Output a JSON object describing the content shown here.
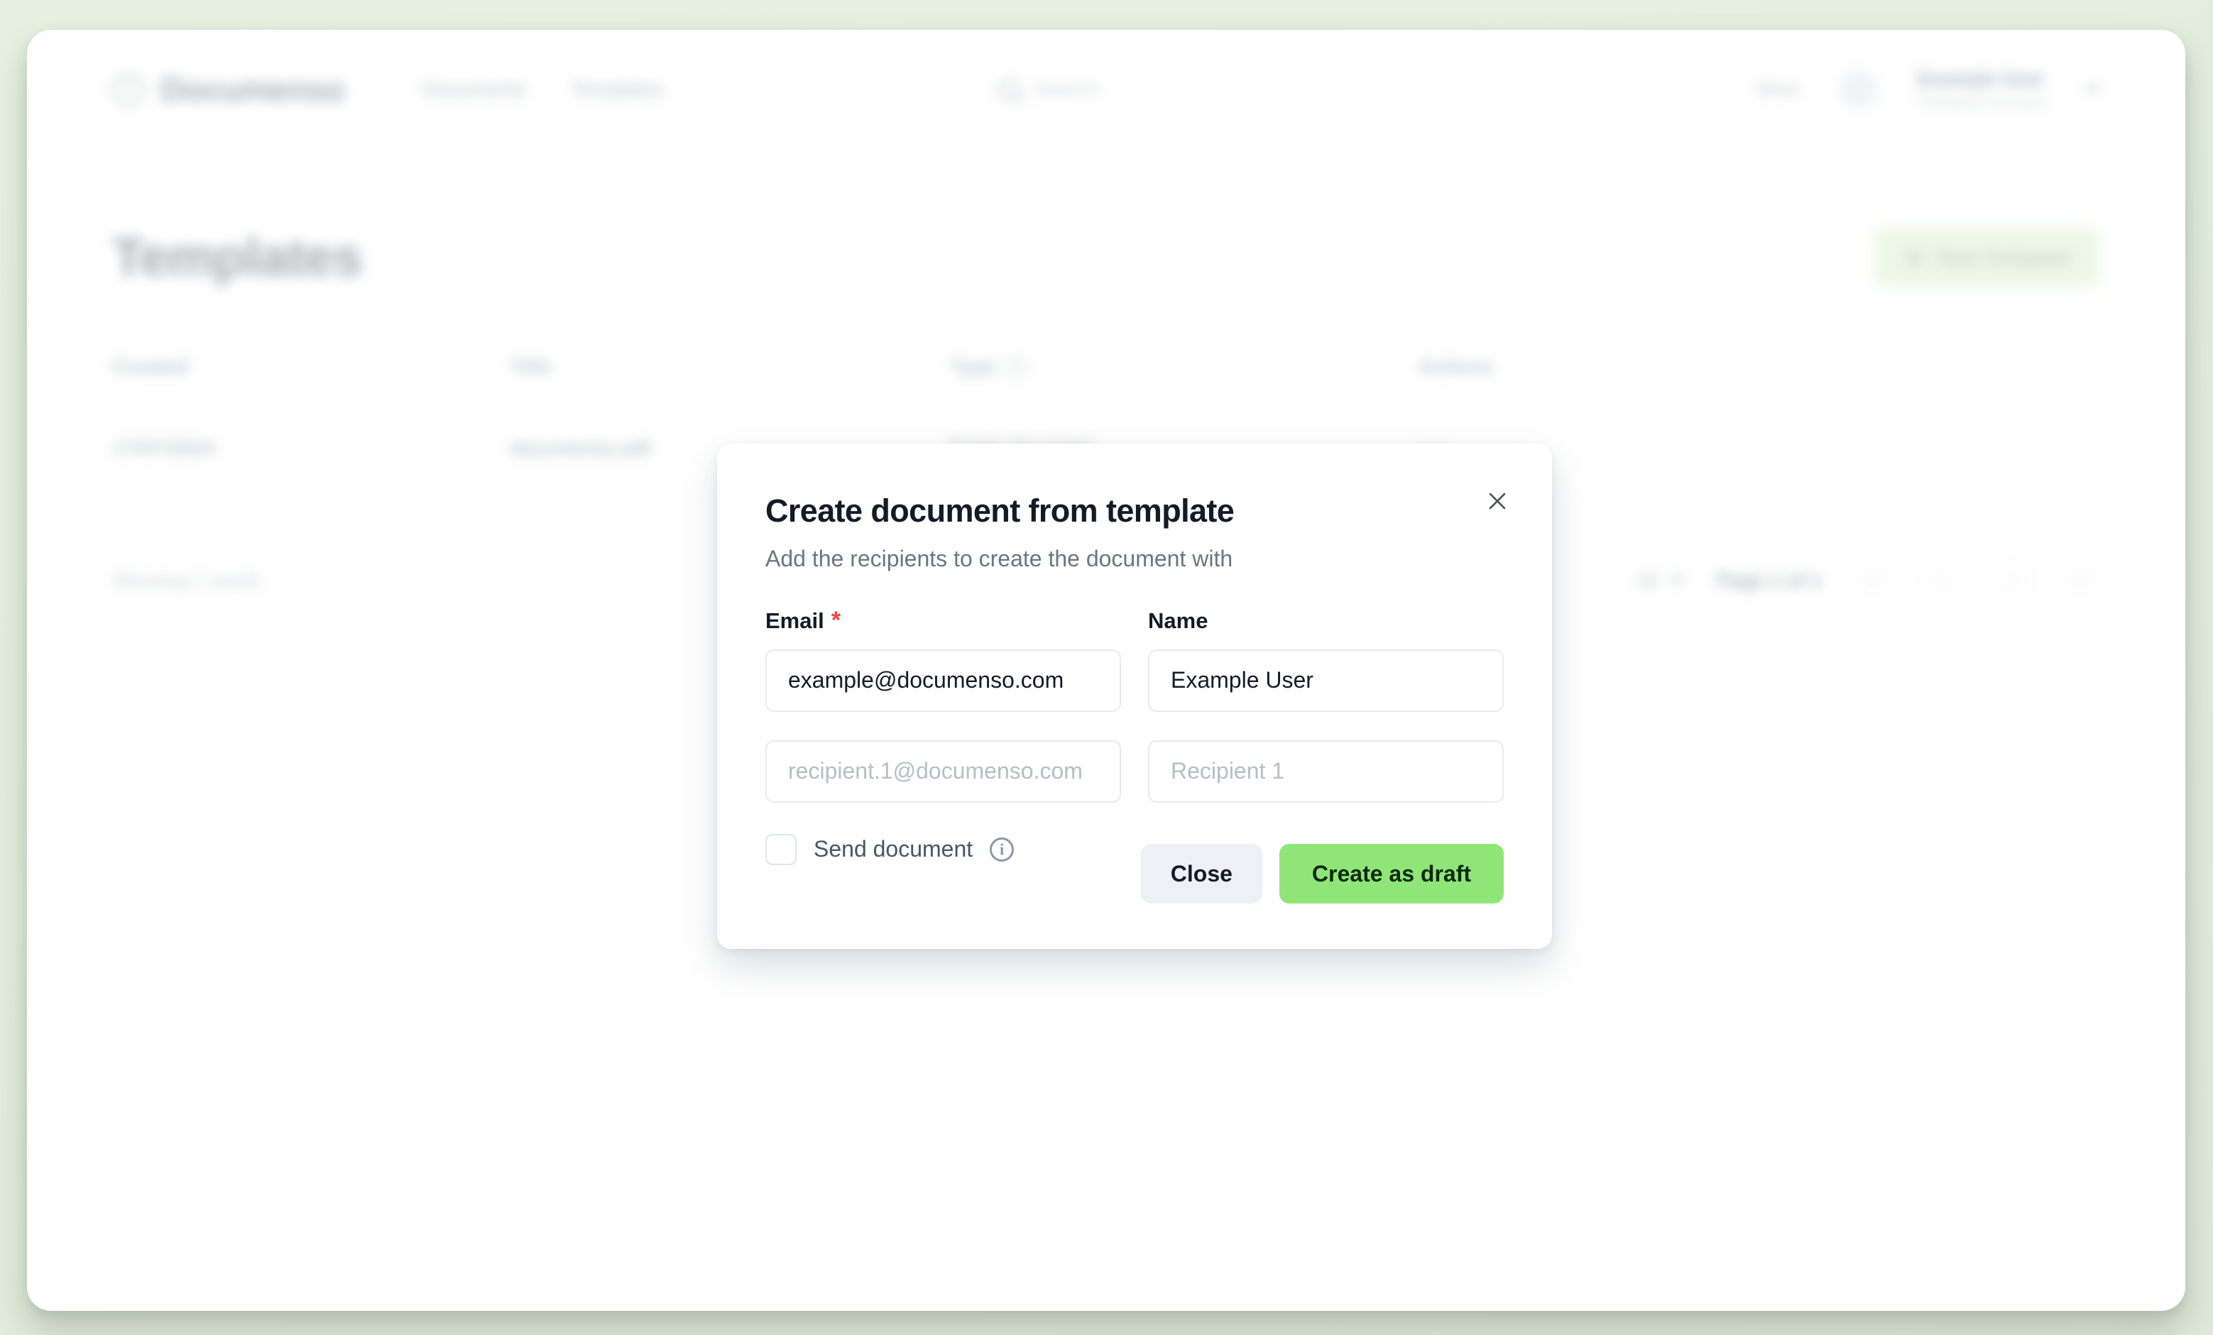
{
  "app": {
    "brand_name": "Documenso",
    "nav_links": [
      {
        "label": "Documents"
      },
      {
        "label": "Templates"
      }
    ],
    "search_placeholder": "Search",
    "nav_separator": "Beta",
    "user": {
      "name": "Example User",
      "subtitle": "Personal Account"
    }
  },
  "page": {
    "title": "Templates",
    "new_template_button": "New Template",
    "table": {
      "columns": [
        "Created",
        "Title",
        "Type",
        "Actions"
      ],
      "rows": [
        {
          "created": "17/07/2024",
          "title": "documenso.pdf",
          "type": "Public Template",
          "actions": "•••"
        }
      ]
    },
    "footer": {
      "showing": "Showing 1 result",
      "rows_per_page": "10",
      "page_label": "Page 1 of 1",
      "first_page": "«",
      "prev_page": "‹",
      "next_page": "›",
      "last_page": "»"
    }
  },
  "dialog": {
    "title": "Create document from template",
    "subtitle": "Add the recipients to create the document with",
    "close_icon": "close-icon",
    "labels": {
      "email": "Email",
      "email_required_marker": "*",
      "name": "Name"
    },
    "recipients": [
      {
        "email_value": "example@documenso.com",
        "email_placeholder": "",
        "name_value": "Example User",
        "name_placeholder": ""
      },
      {
        "email_value": "",
        "email_placeholder": "recipient.1@documenso.com",
        "name_value": "",
        "name_placeholder": "Recipient 1"
      }
    ],
    "send_document": {
      "label": "Send document",
      "checked": false,
      "info_glyph": "i"
    },
    "buttons": {
      "close": "Close",
      "create": "Create as draft"
    }
  },
  "colors": {
    "page_background": "#e2eedc",
    "accent_green": "#90e578",
    "accent_green_text": "#0b2a09",
    "close_button_bg": "#eef0f5",
    "required_red": "#ef4444",
    "title_text": "#151a28",
    "subtitle_text": "#6b7585",
    "placeholder_text": "#b9bcc2"
  }
}
